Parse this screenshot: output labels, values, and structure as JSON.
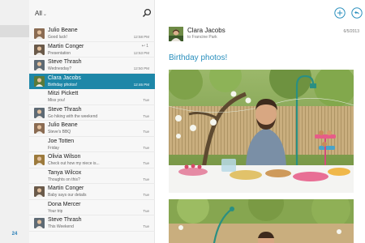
{
  "rail": {
    "unread_count": "24"
  },
  "list_header": {
    "filter_label": "All"
  },
  "messages": [
    {
      "name": "Julio Beane",
      "preview": "Good luck!",
      "time": "12:58 PM",
      "flag": "",
      "avatar_color": "#8a6b52"
    },
    {
      "name": "Martin Conger",
      "preview": "Presentation",
      "time": "12:53 PM",
      "flag": "↩ 1",
      "avatar_color": "#6a5a4a"
    },
    {
      "name": "Steve Thrash",
      "preview": "Wednesday?",
      "time": "12:50 PM",
      "flag": "",
      "avatar_color": "#5e6a74"
    },
    {
      "name": "Clara Jacobs",
      "preview": "Birthday photos!",
      "time": "12:46 PM",
      "flag": "",
      "avatar_color": "#5a7a3a"
    },
    {
      "name": "Mitzi Pickett",
      "preview": "Miss you!",
      "time": "Tue",
      "flag": "",
      "avatar_color": ""
    },
    {
      "name": "Steve Thrash",
      "preview": "Go hiking with the weekend",
      "time": "Tue",
      "flag": "",
      "avatar_color": "#5e6a74"
    },
    {
      "name": "Julio Beane",
      "preview": "Steve's BBQ",
      "time": "Tue",
      "flag": "",
      "avatar_color": "#8a6b52"
    },
    {
      "name": "Joe Totten",
      "preview": "Friday",
      "time": "Tue",
      "flag": "",
      "avatar_color": ""
    },
    {
      "name": "Olivia Wilson",
      "preview": "Check out how my niece is...",
      "time": "Tue",
      "flag": "",
      "avatar_color": "#9c7a3c"
    },
    {
      "name": "Tanya Wilcox",
      "preview": "Thoughts on this?",
      "time": "Tue",
      "flag": "",
      "avatar_color": ""
    },
    {
      "name": "Martin Conger",
      "preview": "Baby says our details",
      "time": "Tue",
      "flag": "",
      "avatar_color": "#6a5a4a"
    },
    {
      "name": "Dona Mercer",
      "preview": "Your trip",
      "time": "Tue",
      "flag": "",
      "avatar_color": ""
    },
    {
      "name": "Steve Thrash",
      "preview": "This Weekend",
      "time": "Tue",
      "flag": "",
      "avatar_color": "#5e6a74"
    }
  ],
  "reader": {
    "sender": "Clara Jacobs",
    "recipient": "to Francine Park",
    "date": "6/5/2013",
    "subject": "Birthday photos!"
  },
  "colors": {
    "accent": "#1e87a8",
    "link": "#2a8fbd"
  }
}
